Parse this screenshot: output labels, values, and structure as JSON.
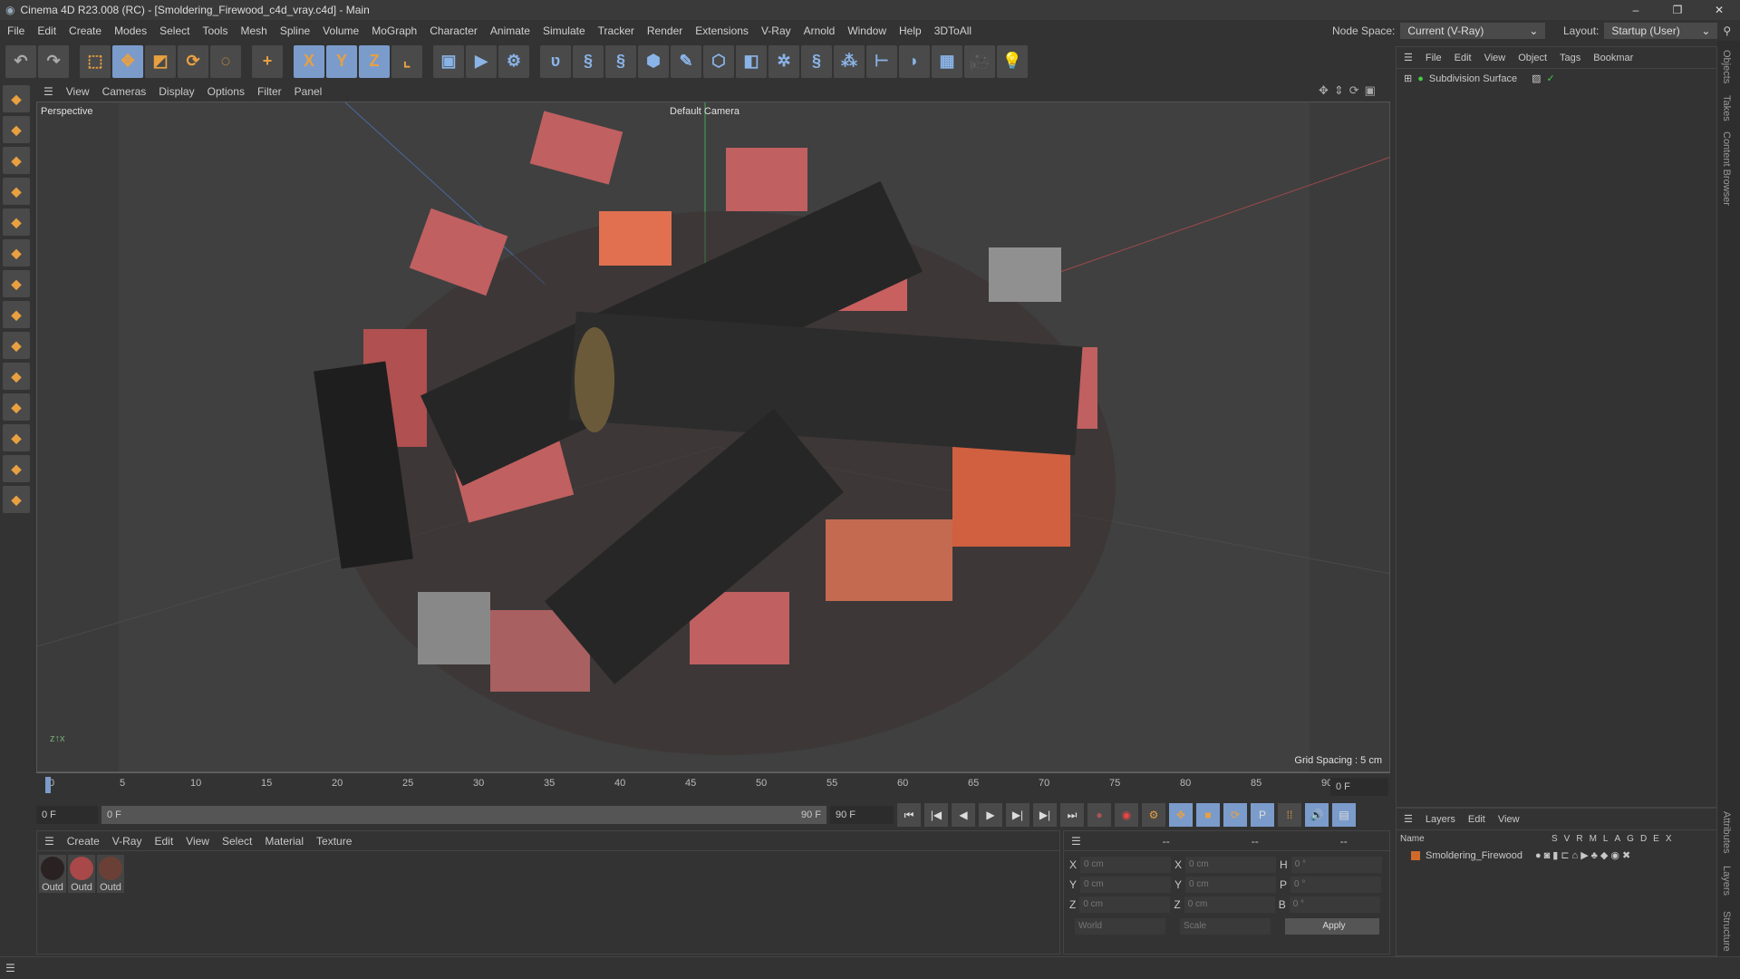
{
  "window": {
    "title": "Cinema 4D R23.008 (RC) - [Smoldering_Firewood_c4d_vray.c4d] - Main",
    "controls": [
      "–",
      "❐",
      "✕"
    ]
  },
  "menu": [
    "File",
    "Edit",
    "Create",
    "Modes",
    "Select",
    "Tools",
    "Mesh",
    "Spline",
    "Volume",
    "MoGraph",
    "Character",
    "Animate",
    "Simulate",
    "Tracker",
    "Render",
    "Extensions",
    "V-Ray",
    "Arnold",
    "Window",
    "Help",
    "3DToAll"
  ],
  "node_space": {
    "label": "Node Space:",
    "value": "Current (V-Ray)"
  },
  "layout": {
    "label": "Layout:",
    "value": "Startup (User)"
  },
  "toolbar_icons": [
    "undo-icon",
    "redo-icon",
    "select-icon",
    "move-icon",
    "scale-icon",
    "rotate-icon",
    "psr-icon",
    "add-icon",
    "x-axis-icon",
    "y-axis-icon",
    "z-axis-icon",
    "coordinate-system-icon",
    "render-view-icon",
    "render-icon",
    "render-settings-icon",
    "vray-icon",
    "python-icon",
    "python-icon",
    "cube-icon",
    "pen-icon",
    "subdivision-icon",
    "extrude-icon",
    "mograph-icon",
    "python-icon",
    "cloner-icon",
    "deformer-icon",
    "floor-icon",
    "sky-icon",
    "camera-icon",
    "light-icon"
  ],
  "viewport": {
    "menu": [
      "View",
      "Cameras",
      "Display",
      "Options",
      "Filter",
      "Panel"
    ],
    "label": "Perspective",
    "camera": "Default Camera",
    "grid_spacing": "Grid Spacing : 5 cm"
  },
  "timeline": {
    "ticks": [
      "0",
      "5",
      "10",
      "15",
      "20",
      "25",
      "30",
      "35",
      "40",
      "45",
      "50",
      "55",
      "60",
      "65",
      "70",
      "75",
      "80",
      "85",
      "90"
    ],
    "current": "0 F",
    "start": "0 F",
    "range_start": "0 F",
    "range_end": "90 F",
    "end": "90 F",
    "frame_field": "0 F"
  },
  "materials": {
    "menu": [
      "Create",
      "V-Ray",
      "Edit",
      "View",
      "Select",
      "Material",
      "Texture"
    ],
    "items": [
      {
        "name": "Outd",
        "color": "#2a2222"
      },
      {
        "name": "Outd",
        "color": "#a84848"
      },
      {
        "name": "Outd",
        "color": "#6a4036"
      }
    ]
  },
  "coordinates": {
    "headers": [
      "--",
      "--",
      "--"
    ],
    "rows": [
      {
        "a": "X",
        "av": "0 cm",
        "b": "X",
        "bv": "0 cm",
        "c": "H",
        "cv": "0 °"
      },
      {
        "a": "Y",
        "av": "0 cm",
        "b": "Y",
        "bv": "0 cm",
        "c": "P",
        "cv": "0 °"
      },
      {
        "a": "Z",
        "av": "0 cm",
        "b": "Z",
        "bv": "0 cm",
        "c": "B",
        "cv": "0 °"
      }
    ],
    "world": "World",
    "scale": "Scale",
    "apply": "Apply"
  },
  "objects": {
    "menu": [
      "File",
      "Edit",
      "View",
      "Object",
      "Tags",
      "Bookmar"
    ],
    "items": [
      {
        "name": "Subdivision Surface"
      }
    ]
  },
  "layers": {
    "menu": [
      "Layers",
      "Edit",
      "View"
    ],
    "columns": [
      "Name",
      "S",
      "V",
      "R",
      "M",
      "L",
      "A",
      "G",
      "D",
      "E",
      "X"
    ],
    "items": [
      {
        "name": "Smoldering_Firewood",
        "color": "#d06a2a"
      }
    ]
  },
  "side_tabs": [
    "Objects",
    "Takes",
    "Content Browser",
    "Attributes",
    "Layers",
    "Structure"
  ]
}
